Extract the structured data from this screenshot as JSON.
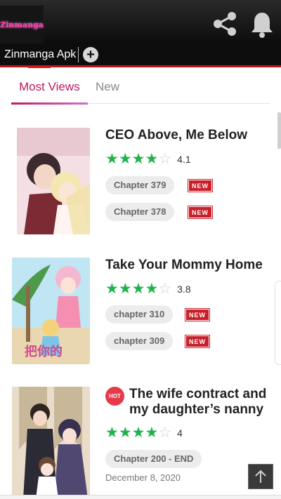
{
  "app": {
    "logo_text": "Zinmanga"
  },
  "header": {
    "icons": [
      "share-icon",
      "bell-icon"
    ]
  },
  "tabstrip": {
    "tab_label": "Zinmanga Apk",
    "add_label": "+"
  },
  "list_tabs": [
    {
      "label": "Most Views",
      "active": true
    },
    {
      "label": "New",
      "active": false
    }
  ],
  "items": [
    {
      "title": "CEO Above, Me Below",
      "rating": "4.1",
      "stars_filled": 4,
      "chapters": [
        {
          "label": "Chapter 379",
          "badge": "NEW"
        },
        {
          "label": "Chapter 378",
          "badge": "NEW"
        }
      ]
    },
    {
      "title": "Take Your Mommy Home",
      "rating": "3.8",
      "stars_filled": 4,
      "chapters": [
        {
          "label": "chapter 310",
          "badge": "NEW"
        },
        {
          "label": "chapter 309",
          "badge": "NEW"
        }
      ]
    },
    {
      "title_line1": "The wife contract and",
      "title_line2": "my daughter’s nanny",
      "hot_badge": "HOT",
      "rating": "4",
      "stars_filled": 4,
      "chapters": [
        {
          "label": "Chapter 200 - END"
        }
      ],
      "date": "December 8, 2020"
    }
  ],
  "colors": {
    "accent": "#c2185b",
    "star": "#22b14c",
    "new_badge": "#c8202a",
    "tab_bar_underline": "#c0141a"
  }
}
